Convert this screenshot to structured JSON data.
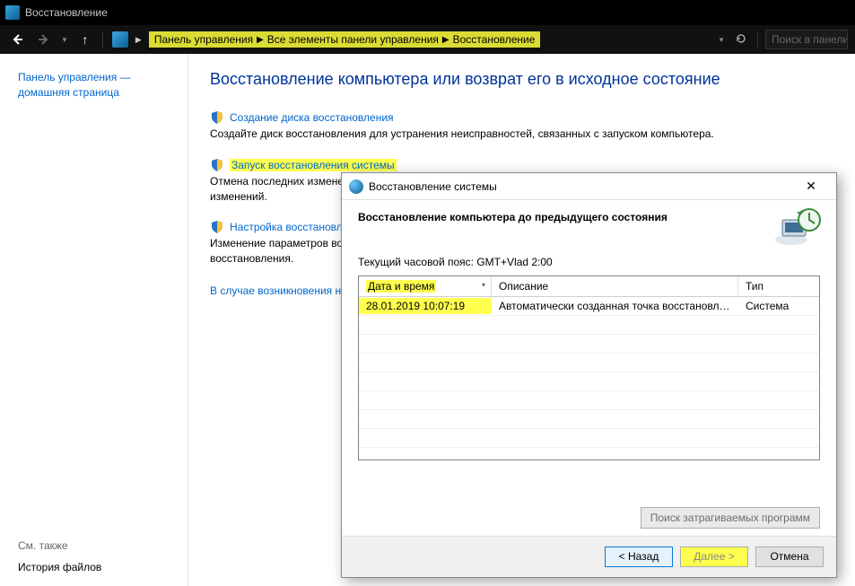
{
  "titlebar": {
    "title": "Восстановление"
  },
  "nav": {
    "crumb1": "Панель управления",
    "crumb2": "Все элементы панели управления",
    "crumb3": "Восстановление",
    "search_placeholder": "Поиск в панели"
  },
  "sidebar": {
    "home_link": "Панель управления — домашняя страница",
    "see_also": "См. также",
    "history": "История файлов"
  },
  "main": {
    "title": "Восстановление компьютера или возврат его в исходное состояние",
    "links": [
      {
        "label": "Создание диска восстановления",
        "desc": "Создайте диск восстановления для устранения неисправностей, связанных с запуском компьютера."
      },
      {
        "label": "Запуск восстановления системы",
        "desc": "Отмена последних изменений системы, однако такие файлы, как документы, изображения и музыка, остаются без изменений."
      },
      {
        "label": "Настройка восстановления системы",
        "desc": "Изменение параметров восстановления, управление дисковым пространством и создание или удаление точек восстановления."
      }
    ],
    "note": "В случае возникновения неполадок с компьютером перейдите к его параметрам, чтобы сбросить или изменить их."
  },
  "dialog": {
    "title": "Восстановление системы",
    "heading": "Восстановление компьютера до предыдущего состояния",
    "tz": "Текущий часовой пояс: GMT+Vlad 2:00",
    "cols": {
      "date": "Дата и время",
      "desc": "Описание",
      "type": "Тип"
    },
    "rows": [
      {
        "date": "28.01.2019 10:07:19",
        "desc": "Автоматически созданная точка восстановле...",
        "type": "Система"
      }
    ],
    "affected": "Поиск затрагиваемых программ",
    "back": "< Назад",
    "next": "Далее >",
    "cancel": "Отмена"
  }
}
